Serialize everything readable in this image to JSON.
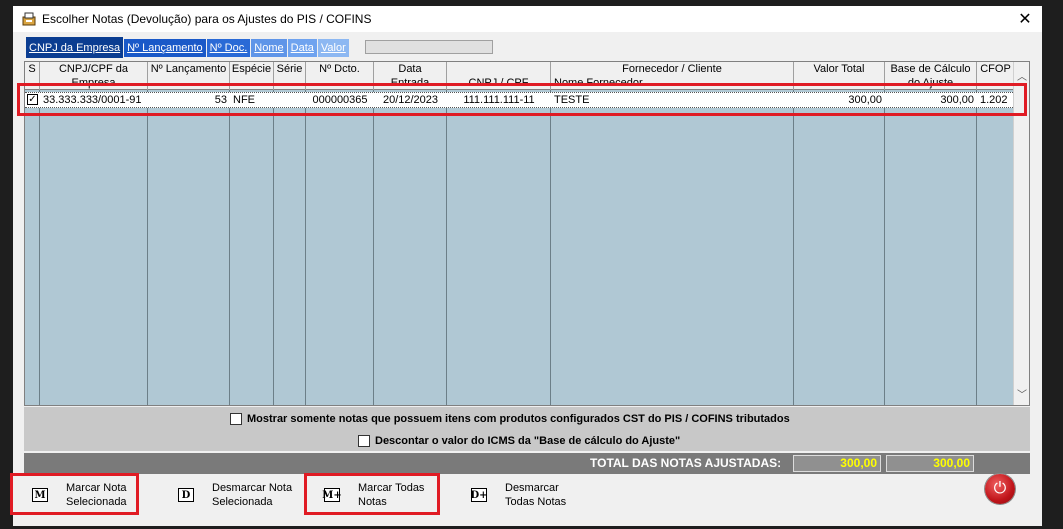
{
  "window": {
    "title": "Escolher Notas (Devolução) para os Ajustes do PIS / COFINS",
    "close_glyph": "✕"
  },
  "tabs": [
    {
      "label": "CNPJ da Empresa"
    },
    {
      "label": "Nº Lançamento"
    },
    {
      "label": "Nº Doc."
    },
    {
      "label": "Nome"
    },
    {
      "label": "Data"
    },
    {
      "label": "Valor"
    }
  ],
  "grid": {
    "headers": [
      {
        "l1": "S",
        "l2": ""
      },
      {
        "l1": "CNPJ/CPF da",
        "l2": "Empresa"
      },
      {
        "l1": "Nº Lançamento",
        "l2": ""
      },
      {
        "l1": "Espécie",
        "l2": ""
      },
      {
        "l1": "Série",
        "l2": ""
      },
      {
        "l1": "Nº Dcto.",
        "l2": ""
      },
      {
        "l1": "Data",
        "l2": "Entrada"
      },
      {
        "l1": "",
        "l2": "CNPJ / CPF"
      },
      {
        "l1": "Fornecedor / Cliente",
        "l2": "Nome Fornecedor"
      },
      {
        "l1": "Valor Total",
        "l2": ""
      },
      {
        "l1": "Base de Cálculo",
        "l2": "do Ajuste"
      },
      {
        "l1": "CFOP",
        "l2": ""
      }
    ],
    "rows": [
      {
        "checked": "✓",
        "cnpj": "33.333.333/0001-91",
        "lancamento": "53",
        "especie": "NFE",
        "serie": "",
        "dcto": "000000365",
        "data": "20/12/2023",
        "cnpj_forn": "111.111.111-11",
        "nome": "TESTE",
        "valor_total": "300,00",
        "base_calculo": "300,00",
        "cfop": "1.202"
      }
    ]
  },
  "options": {
    "opt1": "Mostrar somente notas que possuem itens com produtos configurados CST do PIS / COFINS tributados",
    "opt2": "Descontar o valor do ICMS da \"Base de cálculo do Ajuste\""
  },
  "totals": {
    "label": "TOTAL DAS NOTAS AJUSTADAS:",
    "valor_total": "300,00",
    "base_calculo": "300,00"
  },
  "buttons": {
    "marcar": {
      "icon": "M",
      "l1": "Marcar Nota",
      "l2": "Selecionada"
    },
    "desmarcar": {
      "icon": "D",
      "l1": "Desmarcar Nota",
      "l2": "Selecionada"
    },
    "marcar_todas": {
      "icon": "M+",
      "l1": "Marcar Todas",
      "l2": "Notas"
    },
    "desmarcar_todas": {
      "icon": "D+",
      "l1": "Desmarcar",
      "l2": "Todas Notas"
    }
  },
  "colors": {
    "highlight": "#e01b24",
    "grid_bg": "#b0c8d4",
    "total_value": "#ffff00"
  }
}
